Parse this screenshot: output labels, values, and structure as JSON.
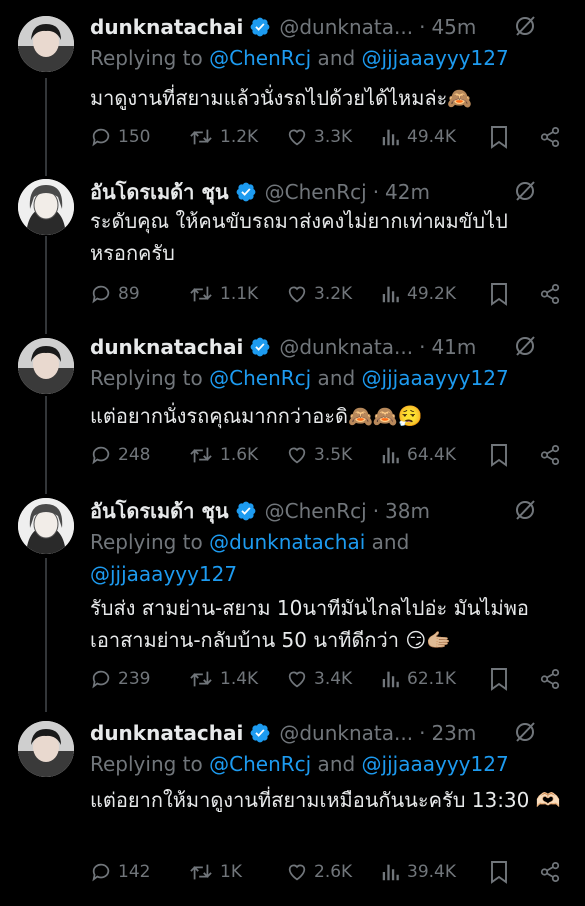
{
  "thread": [
    {
      "display_name": "dunknatachai",
      "handle": "@dunknata...",
      "time": "45m",
      "replying_prefix": "Replying to ",
      "replying_mention_1": "@ChenRcj",
      "replying_and": " and ",
      "replying_mention_2": "@jjjaaayyy127",
      "text": "มาดูงานที่สยามแล้วนั่งรถไปด้วยได้ไหมล่ะ🙈",
      "replies": "150",
      "reposts": "1.2K",
      "likes": "3.3K",
      "views": "49.4K"
    },
    {
      "display_name": "อันโดรเมด้า ชุน",
      "handle": "@ChenRcj",
      "time": "42m",
      "text": "ระดับคุณ ให้คนขับรถมาส่งคงไม่ยากเท่าผมขับไป หรอกครับ",
      "replies": "89",
      "reposts": "1.1K",
      "likes": "3.2K",
      "views": "49.2K"
    },
    {
      "display_name": "dunknatachai",
      "handle": "@dunknata...",
      "time": "41m",
      "replying_prefix": "Replying to ",
      "replying_mention_1": "@ChenRcj",
      "replying_and": " and ",
      "replying_mention_2": "@jjjaaayyy127",
      "text": "แต่อยากนั่งรถคุณมากกว่าอะดิ🙈🙈😮‍💨",
      "replies": "248",
      "reposts": "1.6K",
      "likes": "3.5K",
      "views": "64.4K"
    },
    {
      "display_name": "อันโดรเมด้า ชุน",
      "handle": "@ChenRcj",
      "time": "38m",
      "replying_prefix": "Replying to ",
      "replying_mention_1": "@dunknatachai",
      "replying_and": " and",
      "replying_mention_2": "@jjjaaayyy127",
      "text": "รับส่ง สามย่าน-สยาม 10นาทีมันไกลไปอ่ะ มันไม่พอ เอาสามย่าน-กลับบ้าน 50 นาทีดีกว่า 😏🫱🏼",
      "replies": "239",
      "reposts": "1.4K",
      "likes": "3.4K",
      "views": "62.1K"
    },
    {
      "display_name": "dunknatachai",
      "handle": "@dunknata...",
      "time": "23m",
      "replying_prefix": "Replying to ",
      "replying_mention_1": "@ChenRcj",
      "replying_and": " and ",
      "replying_mention_2": "@jjjaaayyy127",
      "text": "แต่อยากให้มาดูงานที่สยามเหมือนกันนะครับ 13:30 🫶🏻",
      "replies": "142",
      "reposts": "1K",
      "likes": "2.6K",
      "views": "39.4K"
    }
  ],
  "colors": {
    "background": "#000000",
    "text": "#e7e9ea",
    "secondary": "#71767b",
    "accent": "#1d9bf0",
    "thread_line": "#333639"
  },
  "icons": [
    "verified-badge-icon",
    "grok-icon",
    "reply-icon",
    "repost-icon",
    "like-icon",
    "views-icon",
    "bookmark-icon",
    "share-icon"
  ]
}
